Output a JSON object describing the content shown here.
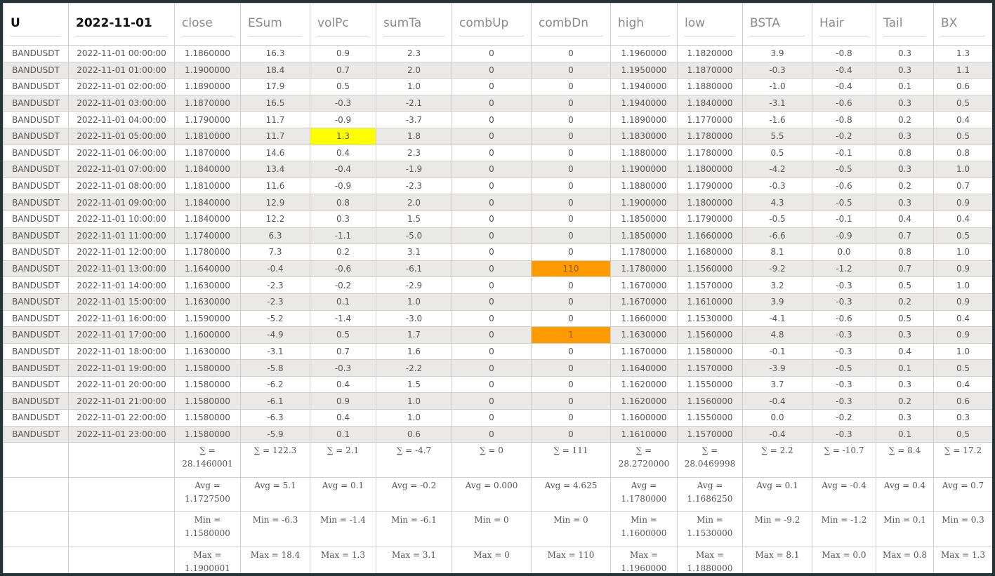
{
  "columns": [
    "U",
    "2022-11-01",
    "close",
    "ESum",
    "volPc",
    "sumTa",
    "combUp",
    "combDn",
    "high",
    "low",
    "BSTA",
    "Hair",
    "Tail",
    "BX"
  ],
  "rows": [
    [
      "BANDUSDT",
      "2022-11-01 00:00:00",
      "1.1860000",
      "16.3",
      "0.9",
      "2.3",
      "0",
      "0",
      "1.1960000",
      "1.1820000",
      "3.9",
      "-0.8",
      "0.3",
      "1.3"
    ],
    [
      "BANDUSDT",
      "2022-11-01 01:00:00",
      "1.1900000",
      "18.4",
      "0.7",
      "2.0",
      "0",
      "0",
      "1.1950000",
      "1.1870000",
      "-0.3",
      "-0.4",
      "0.3",
      "1.1"
    ],
    [
      "BANDUSDT",
      "2022-11-01 02:00:00",
      "1.1890000",
      "17.9",
      "0.5",
      "1.0",
      "0",
      "0",
      "1.1940000",
      "1.1880000",
      "-1.0",
      "-0.4",
      "0.1",
      "0.6"
    ],
    [
      "BANDUSDT",
      "2022-11-01 03:00:00",
      "1.1870000",
      "16.5",
      "-0.3",
      "-2.1",
      "0",
      "0",
      "1.1940000",
      "1.1840000",
      "-3.1",
      "-0.6",
      "0.3",
      "0.5"
    ],
    [
      "BANDUSDT",
      "2022-11-01 04:00:00",
      "1.1790000",
      "11.7",
      "-0.9",
      "-3.7",
      "0",
      "0",
      "1.1890000",
      "1.1770000",
      "-1.6",
      "-0.8",
      "0.2",
      "0.4"
    ],
    [
      "BANDUSDT",
      "2022-11-01 05:00:00",
      "1.1810000",
      "11.7",
      "1.3",
      "1.8",
      "0",
      "0",
      "1.1830000",
      "1.1780000",
      "5.5",
      "-0.2",
      "0.3",
      "0.5"
    ],
    [
      "BANDUSDT",
      "2022-11-01 06:00:00",
      "1.1870000",
      "14.6",
      "0.4",
      "2.3",
      "0",
      "0",
      "1.1880000",
      "1.1780000",
      "0.5",
      "-0.1",
      "0.8",
      "0.8"
    ],
    [
      "BANDUSDT",
      "2022-11-01 07:00:00",
      "1.1840000",
      "13.4",
      "-0.4",
      "-1.9",
      "0",
      "0",
      "1.1900000",
      "1.1800000",
      "-4.2",
      "-0.5",
      "0.3",
      "1.0"
    ],
    [
      "BANDUSDT",
      "2022-11-01 08:00:00",
      "1.1810000",
      "11.6",
      "-0.9",
      "-2.3",
      "0",
      "0",
      "1.1880000",
      "1.1790000",
      "-0.3",
      "-0.6",
      "0.2",
      "0.7"
    ],
    [
      "BANDUSDT",
      "2022-11-01 09:00:00",
      "1.1840000",
      "12.9",
      "0.8",
      "2.0",
      "0",
      "0",
      "1.1900000",
      "1.1800000",
      "4.3",
      "-0.5",
      "0.3",
      "0.9"
    ],
    [
      "BANDUSDT",
      "2022-11-01 10:00:00",
      "1.1840000",
      "12.2",
      "0.3",
      "1.5",
      "0",
      "0",
      "1.1850000",
      "1.1790000",
      "-0.5",
      "-0.1",
      "0.4",
      "0.4"
    ],
    [
      "BANDUSDT",
      "2022-11-01 11:00:00",
      "1.1740000",
      "6.3",
      "-1.1",
      "-5.0",
      "0",
      "0",
      "1.1850000",
      "1.1660000",
      "-6.6",
      "-0.9",
      "0.7",
      "0.5"
    ],
    [
      "BANDUSDT",
      "2022-11-01 12:00:00",
      "1.1780000",
      "7.3",
      "0.2",
      "3.1",
      "0",
      "0",
      "1.1780000",
      "1.1680000",
      "8.1",
      "0.0",
      "0.8",
      "1.0"
    ],
    [
      "BANDUSDT",
      "2022-11-01 13:00:00",
      "1.1640000",
      "-0.4",
      "-0.6",
      "-6.1",
      "0",
      "110",
      "1.1780000",
      "1.1560000",
      "-9.2",
      "-1.2",
      "0.7",
      "0.9"
    ],
    [
      "BANDUSDT",
      "2022-11-01 14:00:00",
      "1.1630000",
      "-2.3",
      "-0.2",
      "-2.9",
      "0",
      "0",
      "1.1670000",
      "1.1570000",
      "3.2",
      "-0.3",
      "0.5",
      "1.0"
    ],
    [
      "BANDUSDT",
      "2022-11-01 15:00:00",
      "1.1630000",
      "-2.3",
      "0.1",
      "1.0",
      "0",
      "0",
      "1.1670000",
      "1.1610000",
      "3.9",
      "-0.3",
      "0.2",
      "0.9"
    ],
    [
      "BANDUSDT",
      "2022-11-01 16:00:00",
      "1.1590000",
      "-5.2",
      "-1.4",
      "-3.0",
      "0",
      "0",
      "1.1660000",
      "1.1530000",
      "-4.1",
      "-0.6",
      "0.5",
      "0.4"
    ],
    [
      "BANDUSDT",
      "2022-11-01 17:00:00",
      "1.1600000",
      "-4.9",
      "0.5",
      "1.7",
      "0",
      "1",
      "1.1630000",
      "1.1560000",
      "4.8",
      "-0.3",
      "0.3",
      "0.9"
    ],
    [
      "BANDUSDT",
      "2022-11-01 18:00:00",
      "1.1630000",
      "-3.1",
      "0.7",
      "1.6",
      "0",
      "0",
      "1.1670000",
      "1.1580000",
      "-0.1",
      "-0.3",
      "0.4",
      "1.0"
    ],
    [
      "BANDUSDT",
      "2022-11-01 19:00:00",
      "1.1580000",
      "-5.8",
      "-0.3",
      "-2.2",
      "0",
      "0",
      "1.1640000",
      "1.1570000",
      "-3.9",
      "-0.5",
      "0.1",
      "0.5"
    ],
    [
      "BANDUSDT",
      "2022-11-01 20:00:00",
      "1.1580000",
      "-6.2",
      "0.4",
      "1.5",
      "0",
      "0",
      "1.1620000",
      "1.1550000",
      "3.7",
      "-0.3",
      "0.3",
      "0.4"
    ],
    [
      "BANDUSDT",
      "2022-11-01 21:00:00",
      "1.1580000",
      "-6.1",
      "0.9",
      "1.0",
      "0",
      "0",
      "1.1620000",
      "1.1560000",
      "-0.4",
      "-0.3",
      "0.2",
      "0.6"
    ],
    [
      "BANDUSDT",
      "2022-11-01 22:00:00",
      "1.1580000",
      "-6.3",
      "0.4",
      "1.0",
      "0",
      "0",
      "1.1600000",
      "1.1550000",
      "0.0",
      "-0.2",
      "0.3",
      "0.3"
    ],
    [
      "BANDUSDT",
      "2022-11-01 23:00:00",
      "1.1580000",
      "-5.9",
      "0.1",
      "0.6",
      "0",
      "0",
      "1.1610000",
      "1.1570000",
      "-0.4",
      "-0.3",
      "0.1",
      "0.5"
    ]
  ],
  "highlights": [
    {
      "row": 5,
      "col": 4,
      "color": "#ffff00"
    },
    {
      "row": 13,
      "col": 7,
      "color": "#ff9b00"
    },
    {
      "row": 17,
      "col": 7,
      "color": "#ff9b00"
    }
  ],
  "summary": [
    [
      "",
      "",
      "∑ = 28.1460001",
      "∑ = 122.3",
      "∑ = 2.1",
      "∑ = -4.7",
      "∑ = 0",
      "∑ = 111",
      "∑ = 28.2720000",
      "∑ = 28.0469998",
      "∑ = 2.2",
      "∑ = -10.7",
      "∑ = 8.4",
      "∑ = 17.2"
    ],
    [
      "",
      "",
      "Avg = 1.1727500",
      "Avg = 5.1",
      "Avg = 0.1",
      "Avg = -0.2",
      "Avg = 0.000",
      "Avg = 4.625",
      "Avg = 1.1780000",
      "Avg = 1.1686250",
      "Avg = 0.1",
      "Avg = -0.4",
      "Avg = 0.4",
      "Avg = 0.7"
    ],
    [
      "",
      "",
      "Min = 1.1580000",
      "Min = -6.3",
      "Min = -1.4",
      "Min = -6.1",
      "Min = 0",
      "Min = 0",
      "Min = 1.1600000",
      "Min = 1.1530000",
      "Min = -9.2",
      "Min = -1.2",
      "Min = 0.1",
      "Min = 0.3"
    ],
    [
      "",
      "",
      "Max = 1.1900001",
      "Max = 18.4",
      "Max = 1.3",
      "Max = 3.1",
      "Max = 0",
      "Max = 110",
      "Max = 1.1960000",
      "Max = 1.1880000",
      "Max = 8.1",
      "Max = 0.0",
      "Max = 0.8",
      "Max = 1.3"
    ]
  ]
}
